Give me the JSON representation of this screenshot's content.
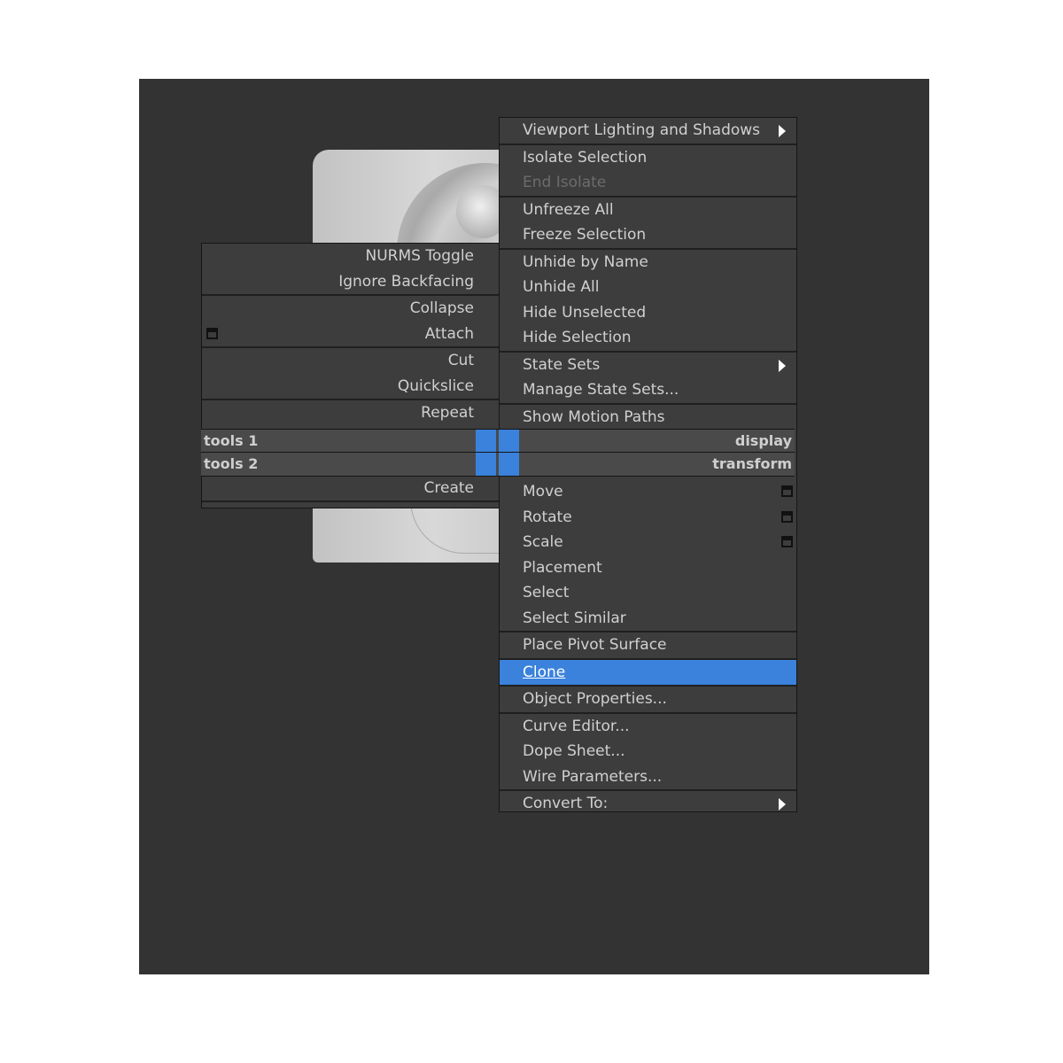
{
  "quad_left": {
    "items": [
      "NURMS Toggle",
      "Ignore Backfacing",
      "Collapse",
      "Attach",
      "Cut",
      "Quickslice",
      "Repeat",
      "Create"
    ]
  },
  "quad_right": {
    "items": [
      "Viewport Lighting and Shadows",
      "Isolate Selection",
      "End Isolate",
      "Unfreeze All",
      "Freeze Selection",
      "Unhide by Name",
      "Unhide All",
      "Hide Unselected",
      "Hide Selection",
      "State Sets",
      "Manage State Sets...",
      "Show Motion Paths",
      "Move",
      "Rotate",
      "Scale",
      "Placement",
      "Select",
      "Select Similar",
      "Place Pivot Surface",
      "Clone",
      "Object Properties...",
      "Curve Editor...",
      "Dope Sheet...",
      "Wire Parameters...",
      "Convert To:"
    ]
  },
  "headers": {
    "tools1": "tools 1",
    "tools2": "tools 2",
    "display": "display",
    "transform": "transform"
  },
  "colors": {
    "viewport_bg": "#333333",
    "menu_bg": "#3d3d3d",
    "highlight": "#3a82dc"
  },
  "highlighted_item": "Clone",
  "icons": [
    "submenu-arrow-icon",
    "option-box-icon"
  ]
}
